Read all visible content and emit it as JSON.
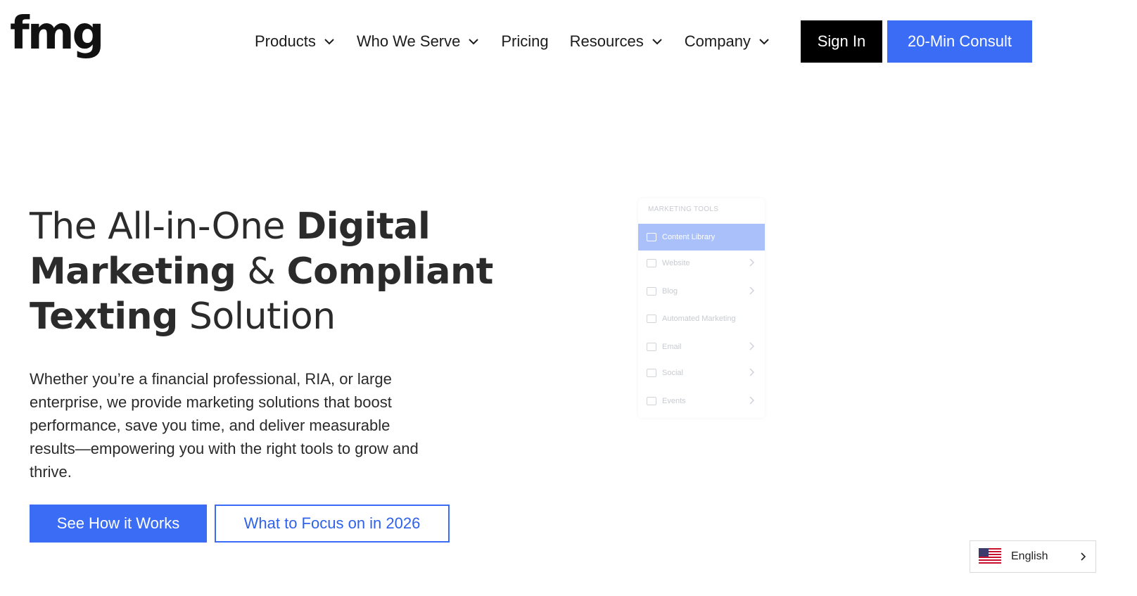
{
  "brand": {
    "logo_text": "fmg"
  },
  "nav": {
    "items": [
      {
        "label": "Products",
        "has_dropdown": true
      },
      {
        "label": "Who We Serve",
        "has_dropdown": true
      },
      {
        "label": "Pricing",
        "has_dropdown": false
      },
      {
        "label": "Resources",
        "has_dropdown": true
      },
      {
        "label": "Company",
        "has_dropdown": true
      }
    ],
    "signin_label": "Sign In",
    "consult_label": "20-Min Consult"
  },
  "hero": {
    "headline": {
      "part1": "The All-in-One ",
      "bold1": "Digital Marketing",
      "part2": " & ",
      "bold2": "Compliant Texting",
      "part3": " Solution"
    },
    "description": "Whether you’re a financial professional, RIA, or large enterprise, we provide marketing solutions that boost performance, save you time, and deliver measurable results—empowering you with the right tools to grow and thrive.",
    "primary_cta": "See How it Works",
    "secondary_cta": "What to Focus on in 2026"
  },
  "tools_panel": {
    "title": "MARKETING TOOLS",
    "items": [
      {
        "label": "Content Library",
        "icon": "library-icon",
        "active": true,
        "chevron": false
      },
      {
        "label": "Website",
        "icon": "monitor-icon",
        "active": false,
        "chevron": true
      },
      {
        "label": "Blog",
        "icon": "blog-icon",
        "active": false,
        "chevron": true
      },
      {
        "label": "Automated Marketing",
        "icon": "automation-icon",
        "active": false,
        "chevron": false
      },
      {
        "label": "Email",
        "icon": "mail-icon",
        "active": false,
        "chevron": true
      },
      {
        "label": "Social",
        "icon": "social-icon",
        "active": false,
        "chevron": true
      },
      {
        "label": "Events",
        "icon": "calendar-icon",
        "active": false,
        "chevron": true
      }
    ]
  },
  "language_selector": {
    "label": "English",
    "flag": "us-flag-icon"
  },
  "colors": {
    "accent": "#3b6cf6",
    "signin_bg": "#000000",
    "active_tool": "#a9c0fb"
  }
}
